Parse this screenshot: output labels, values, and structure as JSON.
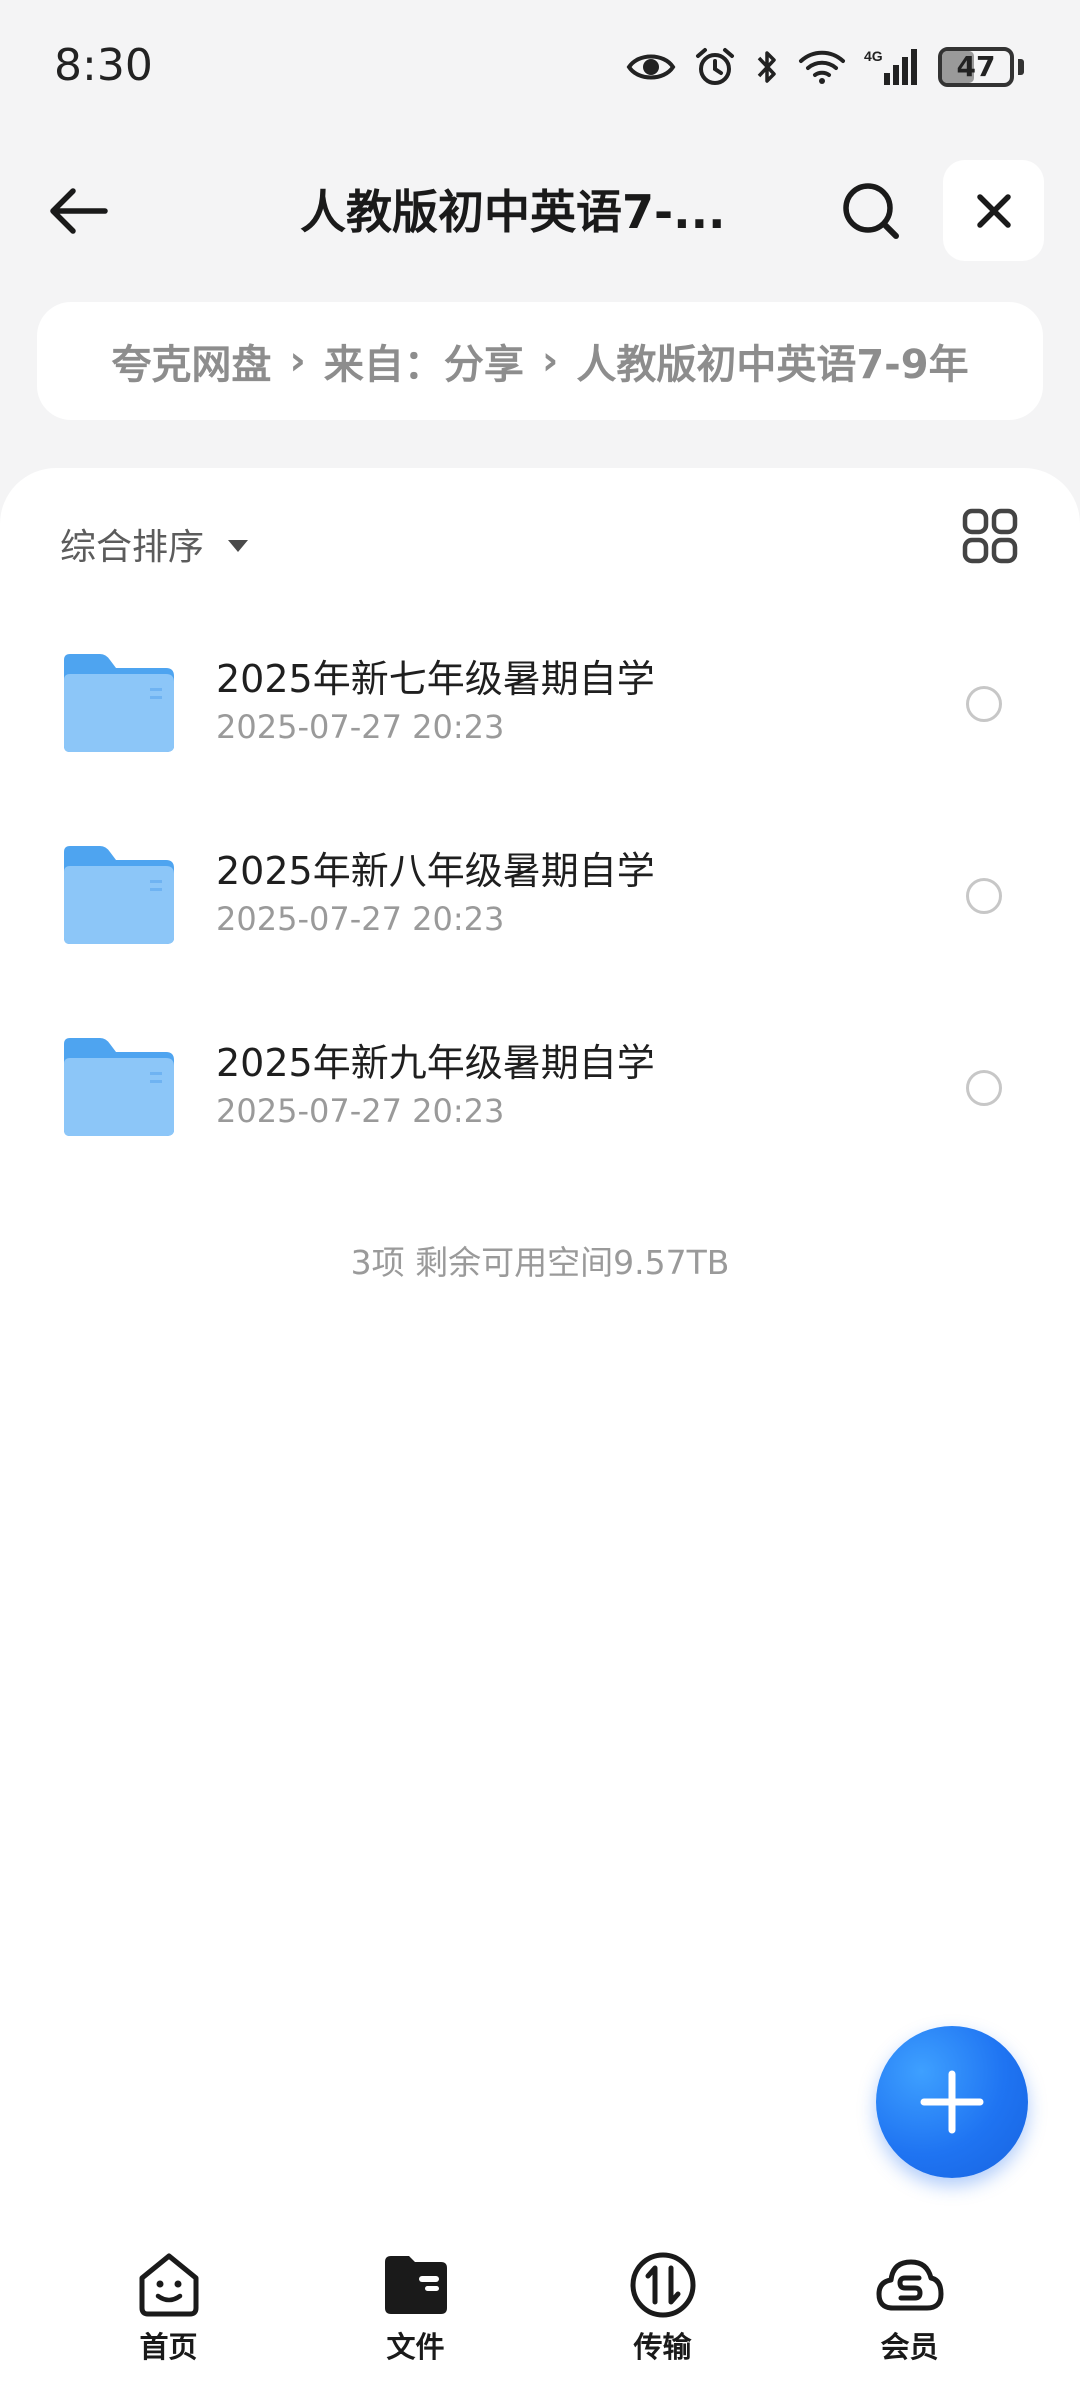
{
  "status_bar": {
    "time": "8:30",
    "battery": "47",
    "battery_level": 0.47,
    "network": "4G",
    "icons": [
      "eye-icon",
      "alarm-icon",
      "bluetooth-icon",
      "wifi-icon",
      "cellular-signal-icon",
      "battery-icon"
    ]
  },
  "header": {
    "title": "人教版初中英语7-...",
    "back_icon": "arrow-left-icon",
    "search_icon": "search-icon",
    "close_icon": "close-icon"
  },
  "breadcrumb": {
    "items": [
      "夸克网盘",
      "来自：分享",
      "人教版初中英语7-9年"
    ],
    "separator": "›"
  },
  "toolbar": {
    "sort_label": "综合排序",
    "view_toggle_icon": "grid-view-icon"
  },
  "files": [
    {
      "name": "2025年新七年级暑期自学",
      "date": "2025-07-27 20:23",
      "icon": "folder-icon"
    },
    {
      "name": "2025年新八年级暑期自学",
      "date": "2025-07-27 20:23",
      "icon": "folder-icon"
    },
    {
      "name": "2025年新九年级暑期自学",
      "date": "2025-07-27 20:23",
      "icon": "folder-icon"
    }
  ],
  "footer": {
    "info": "3项 剩余可用空间9.57TB"
  },
  "fab": {
    "icon": "plus-icon"
  },
  "bottom_nav": [
    {
      "label": "首页",
      "icon": "home-smile-icon"
    },
    {
      "label": "文件",
      "icon": "files-folder-icon",
      "active": true
    },
    {
      "label": "传输",
      "icon": "transfer-icon"
    },
    {
      "label": "会员",
      "icon": "member-cloud-icon"
    }
  ],
  "colors": {
    "accent": "#1f74f2",
    "folder": "#5aaef5",
    "background": "#f4f4f5"
  }
}
